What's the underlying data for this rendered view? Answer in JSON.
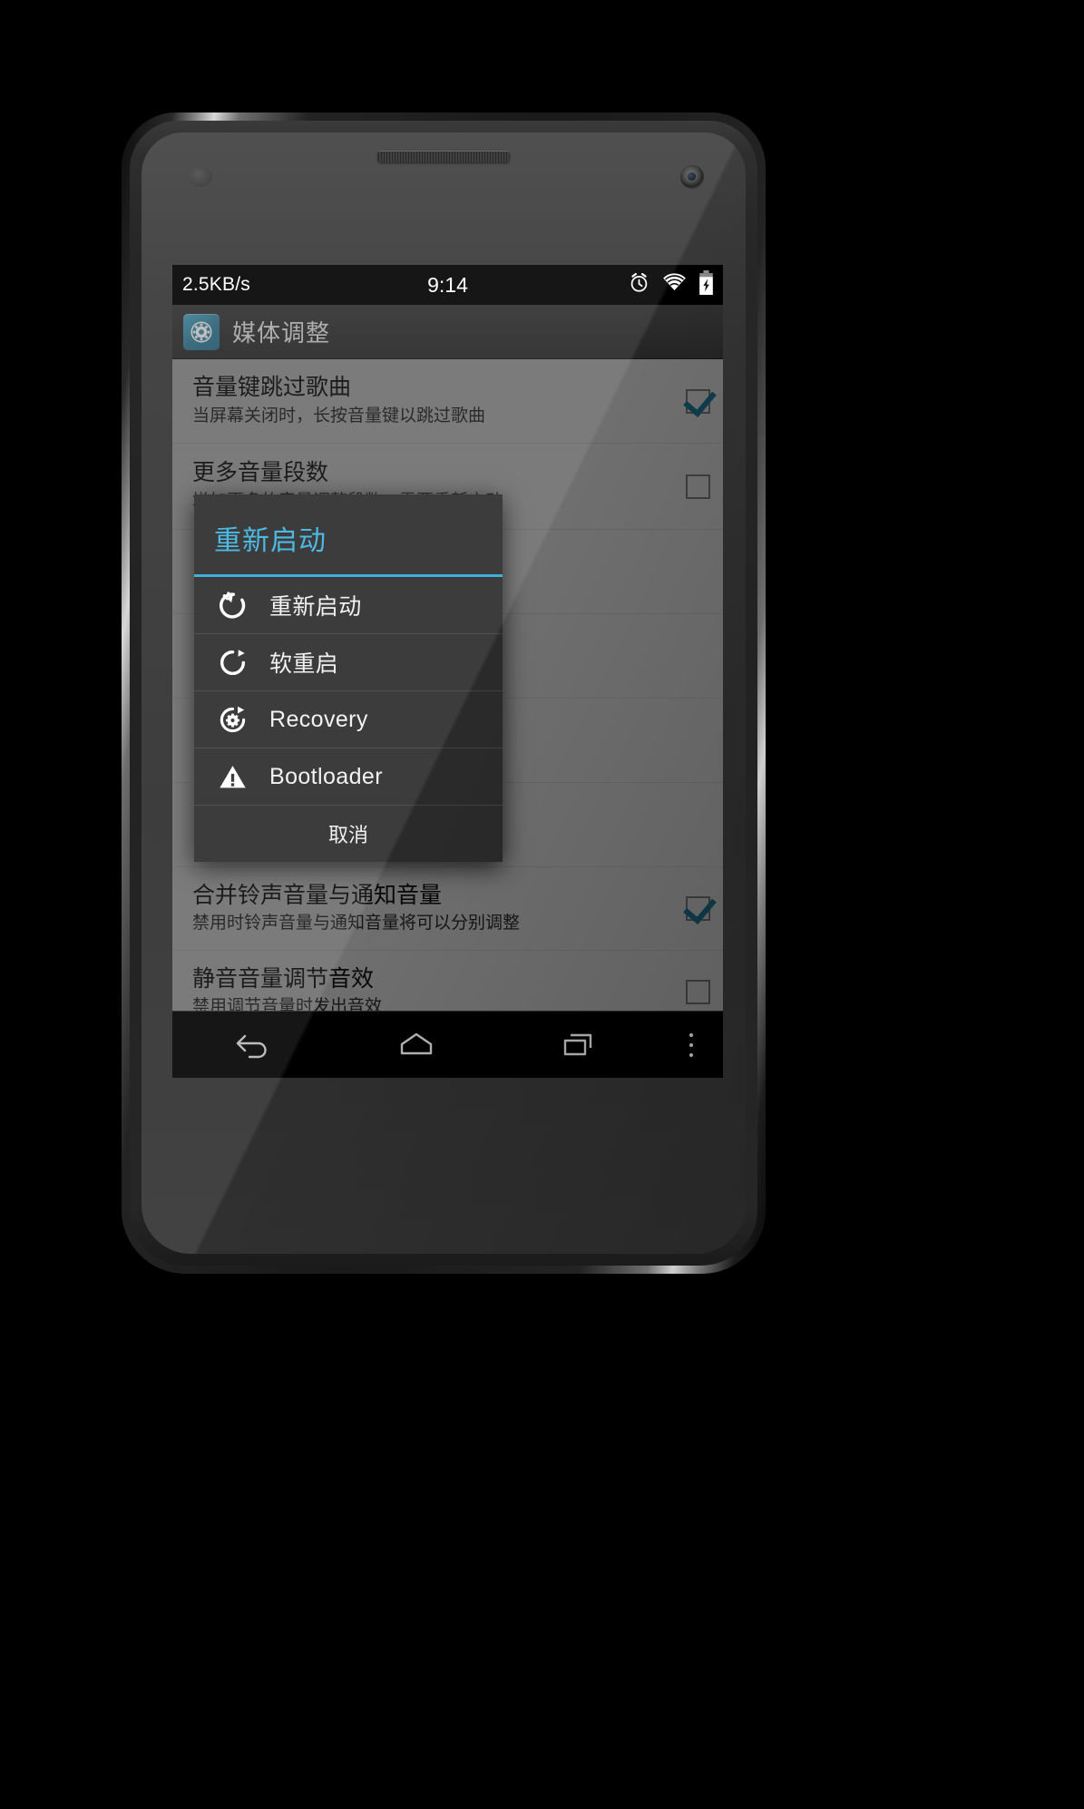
{
  "status_bar": {
    "network_speed": "2.5KB/s",
    "clock": "9:14",
    "icons": [
      "alarm-icon",
      "wifi-icon",
      "battery-charging-icon"
    ]
  },
  "action_bar": {
    "app_icon": "gear-icon",
    "title": "媒体调整"
  },
  "preferences": [
    {
      "title": "音量键跳过歌曲",
      "summary": "当屏幕关闭时，长按音量键以跳过歌曲",
      "checked": true
    },
    {
      "title": "更多音量段数",
      "summary": "增加更多的音量调整段数，需要重新启动",
      "checked": false
    },
    {
      "title": "合并铃声音量与通知音量",
      "summary": "禁用时铃声音量与通知音量将可以分别调整",
      "checked": true
    },
    {
      "title": "静音音量调节音效",
      "summary": "禁用调节音量时发出音效",
      "checked": false
    }
  ],
  "dialog": {
    "title": "重新启动",
    "accent_color": "#33b5e5",
    "items": [
      {
        "label": "重新启动",
        "icon": "power-restart-icon"
      },
      {
        "label": "软重启",
        "icon": "refresh-circle-icon"
      },
      {
        "label": "Recovery",
        "icon": "recovery-gear-icon"
      },
      {
        "label": "Bootloader",
        "icon": "warning-triangle-icon"
      }
    ],
    "cancel_label": "取消"
  },
  "nav_bar": {
    "buttons": [
      "back-icon",
      "home-icon",
      "recents-icon",
      "overflow-menu-icon"
    ]
  }
}
